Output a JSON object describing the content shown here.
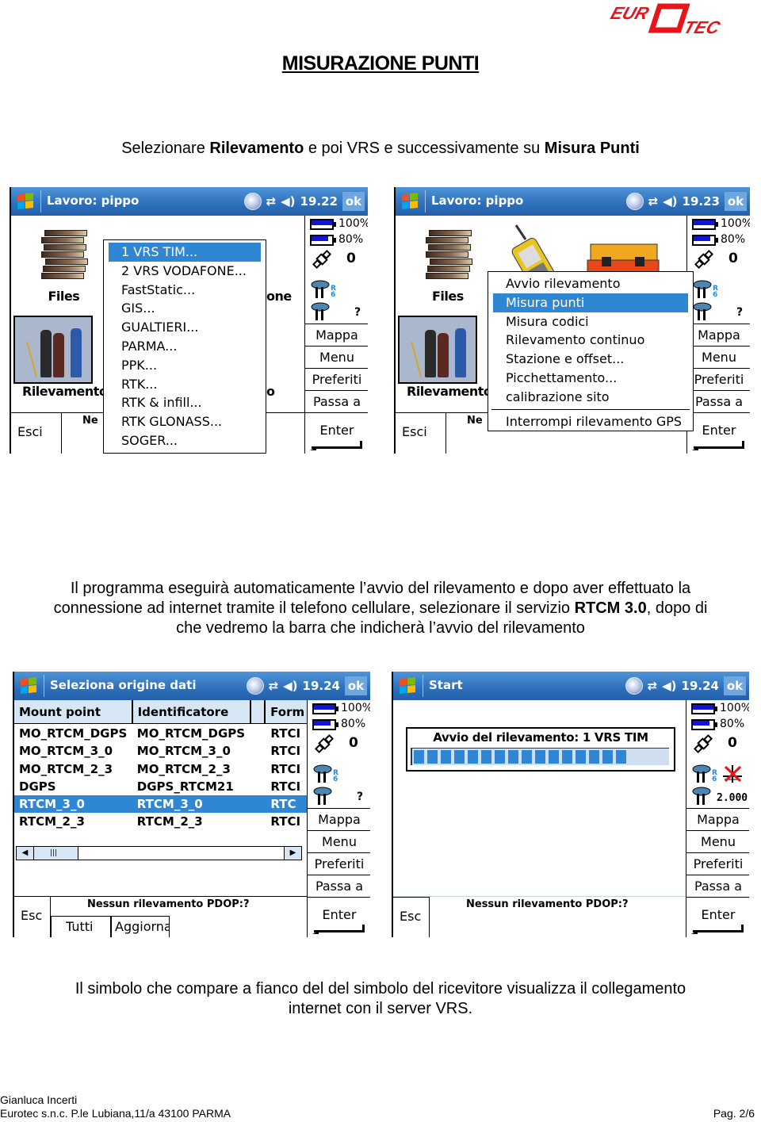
{
  "logo": {
    "text": "EURO TEC",
    "color": "#e8141a"
  },
  "document": {
    "title": "MISURAZIONE PUNTI",
    "intro": {
      "prefix": "Selezionare ",
      "bold1": "Rilevamento",
      "middle": " e poi VRS e successivamente su ",
      "bold2": "Misura Punti"
    },
    "paragraph2": {
      "line1": "Il programma eseguirà automaticamente l’avvio del rilevamento e dopo aver effettuato la",
      "line2_prefix": "connessione ad internet tramite il telefono cellulare, selezionare il servizio ",
      "line2_bold": "RTCM 3.0",
      "line2_suffix": ", dopo di",
      "line3": "che vedremo la barra che indicherà l’avvio del rilevamento"
    },
    "paragraph3": {
      "line1": "Il simbolo che compare a fianco del del simbolo del ricevitore visualizza il collegamento",
      "line2": "internet con il server VRS."
    },
    "footer": {
      "author": "Gianluca Incerti",
      "address": "Eurotec s.n.c. P.le Lubiana,11/a 43100 PARMA",
      "page": "Pag. 2/6"
    }
  },
  "common": {
    "ok_label": "ok",
    "battery1_pct": "100%",
    "battery1_level": 1.0,
    "battery2_pct": "80%",
    "battery2_level": 0.8,
    "satellites": "0",
    "receiver_tag": "R\n6",
    "receiver_q": "?",
    "side_buttons": [
      "Mappa",
      "Menu",
      "Preferiti",
      "Passa a"
    ],
    "enter_label": "Enter",
    "status_msg": "Nessun rilevamento  PDOP:?",
    "colors": {
      "titlebar": "#2d6fba",
      "selection": "#2f86d3",
      "battery": "#1313d8"
    }
  },
  "screen1": {
    "title": "Lavoro: pippo",
    "time": "19.22",
    "tiles": {
      "files": "Files",
      "rilevamento": "Rilevamento",
      "partial_right": "one",
      "partial_right2": "o"
    },
    "esc_label": "Esci",
    "status_partial": "Ne",
    "menu": [
      {
        "label": "1 VRS TIM...",
        "selected": true
      },
      {
        "label": "2 VRS VODAFONE...",
        "selected": false
      },
      {
        "label": "FastStatic...",
        "selected": false
      },
      {
        "label": "GIS...",
        "selected": false
      },
      {
        "label": "GUALTIERI...",
        "selected": false
      },
      {
        "label": "PARMA...",
        "selected": false
      },
      {
        "label": "PPK...",
        "selected": false
      },
      {
        "label": "RTK...",
        "selected": false
      },
      {
        "label": "RTK & infill...",
        "selected": false
      },
      {
        "label": "RTK GLONASS...",
        "selected": false
      },
      {
        "label": "SOGER...",
        "selected": false
      }
    ]
  },
  "screen2": {
    "title": "Lavoro: pippo",
    "time": "19.23",
    "tiles": {
      "files": "Files",
      "rilevamento": "Rilevamento"
    },
    "esc_label": "Esci",
    "status_partial": "Ne",
    "menu": [
      {
        "label": "Avvio rilevamento",
        "selected": false
      },
      {
        "label": "Misura punti",
        "selected": true
      },
      {
        "label": "Misura codici",
        "selected": false
      },
      {
        "label": "Rilevamento continuo",
        "selected": false
      },
      {
        "label": "Stazione e offset...",
        "selected": false
      },
      {
        "label": "Picchettamento...",
        "selected": false
      },
      {
        "label": "calibrazione sito",
        "selected": false
      }
    ],
    "menu_after_sep": {
      "label": "Interrompi rilevamento GPS",
      "selected": false
    }
  },
  "screen3": {
    "title": "Seleziona origine dati",
    "time": "19.24",
    "columns": [
      "Mount point",
      "Identificatore",
      "",
      "Form"
    ],
    "rows": [
      {
        "mount": "MO_RTCM_DGPS",
        "id": "MO_RTCM_DGPS",
        "format": "RTCI",
        "selected": false
      },
      {
        "mount": "MO_RTCM_3_0",
        "id": "MO_RTCM_3_0",
        "format": "RTCI",
        "selected": false
      },
      {
        "mount": "MO_RTCM_2_3",
        "id": "MO_RTCM_2_3",
        "format": "RTCI",
        "selected": false
      },
      {
        "mount": "DGPS",
        "id": "DGPS_RTCM21",
        "format": "RTCI",
        "selected": false
      },
      {
        "mount": "RTCM_3_0",
        "id": "RTCM_3_0",
        "format": "RTC",
        "selected": true
      },
      {
        "mount": "RTCM_2_3",
        "id": "RTCM_2_3",
        "format": "RTCI",
        "selected": false
      }
    ],
    "esc_label": "Esc",
    "tab_all": "Tutti",
    "tab_refresh": "Aggiornar"
  },
  "screen4": {
    "title": "Start",
    "time": "19.24",
    "progress_title": "Avvio del rilevamento: 1 VRS TIM",
    "progress_segments": 16,
    "progress_total_segments": 20,
    "correction_value": "2.000",
    "esc_label": "Esc"
  }
}
